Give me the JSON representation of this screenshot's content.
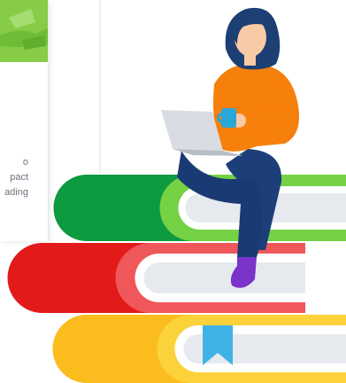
{
  "card": {
    "lines": [
      "o",
      "pact",
      "ading"
    ]
  },
  "colors": {
    "green_book": "#0e9a3f",
    "green_pages": "#74d244",
    "red_book": "#e31a1a",
    "red_pages": "#f0575b",
    "yellow_book": "#fbbd1d",
    "yellow_pages": "#fcd23b",
    "bookmark": "#3fb2e6",
    "sweater": "#f77f0b",
    "jeans": "#1c3f7a",
    "hair": "#1c3f74",
    "skin": "#f8caa5",
    "shoe": "#7a34c9",
    "laptop": "#d9dde3",
    "mug": "#2aa7d9"
  }
}
